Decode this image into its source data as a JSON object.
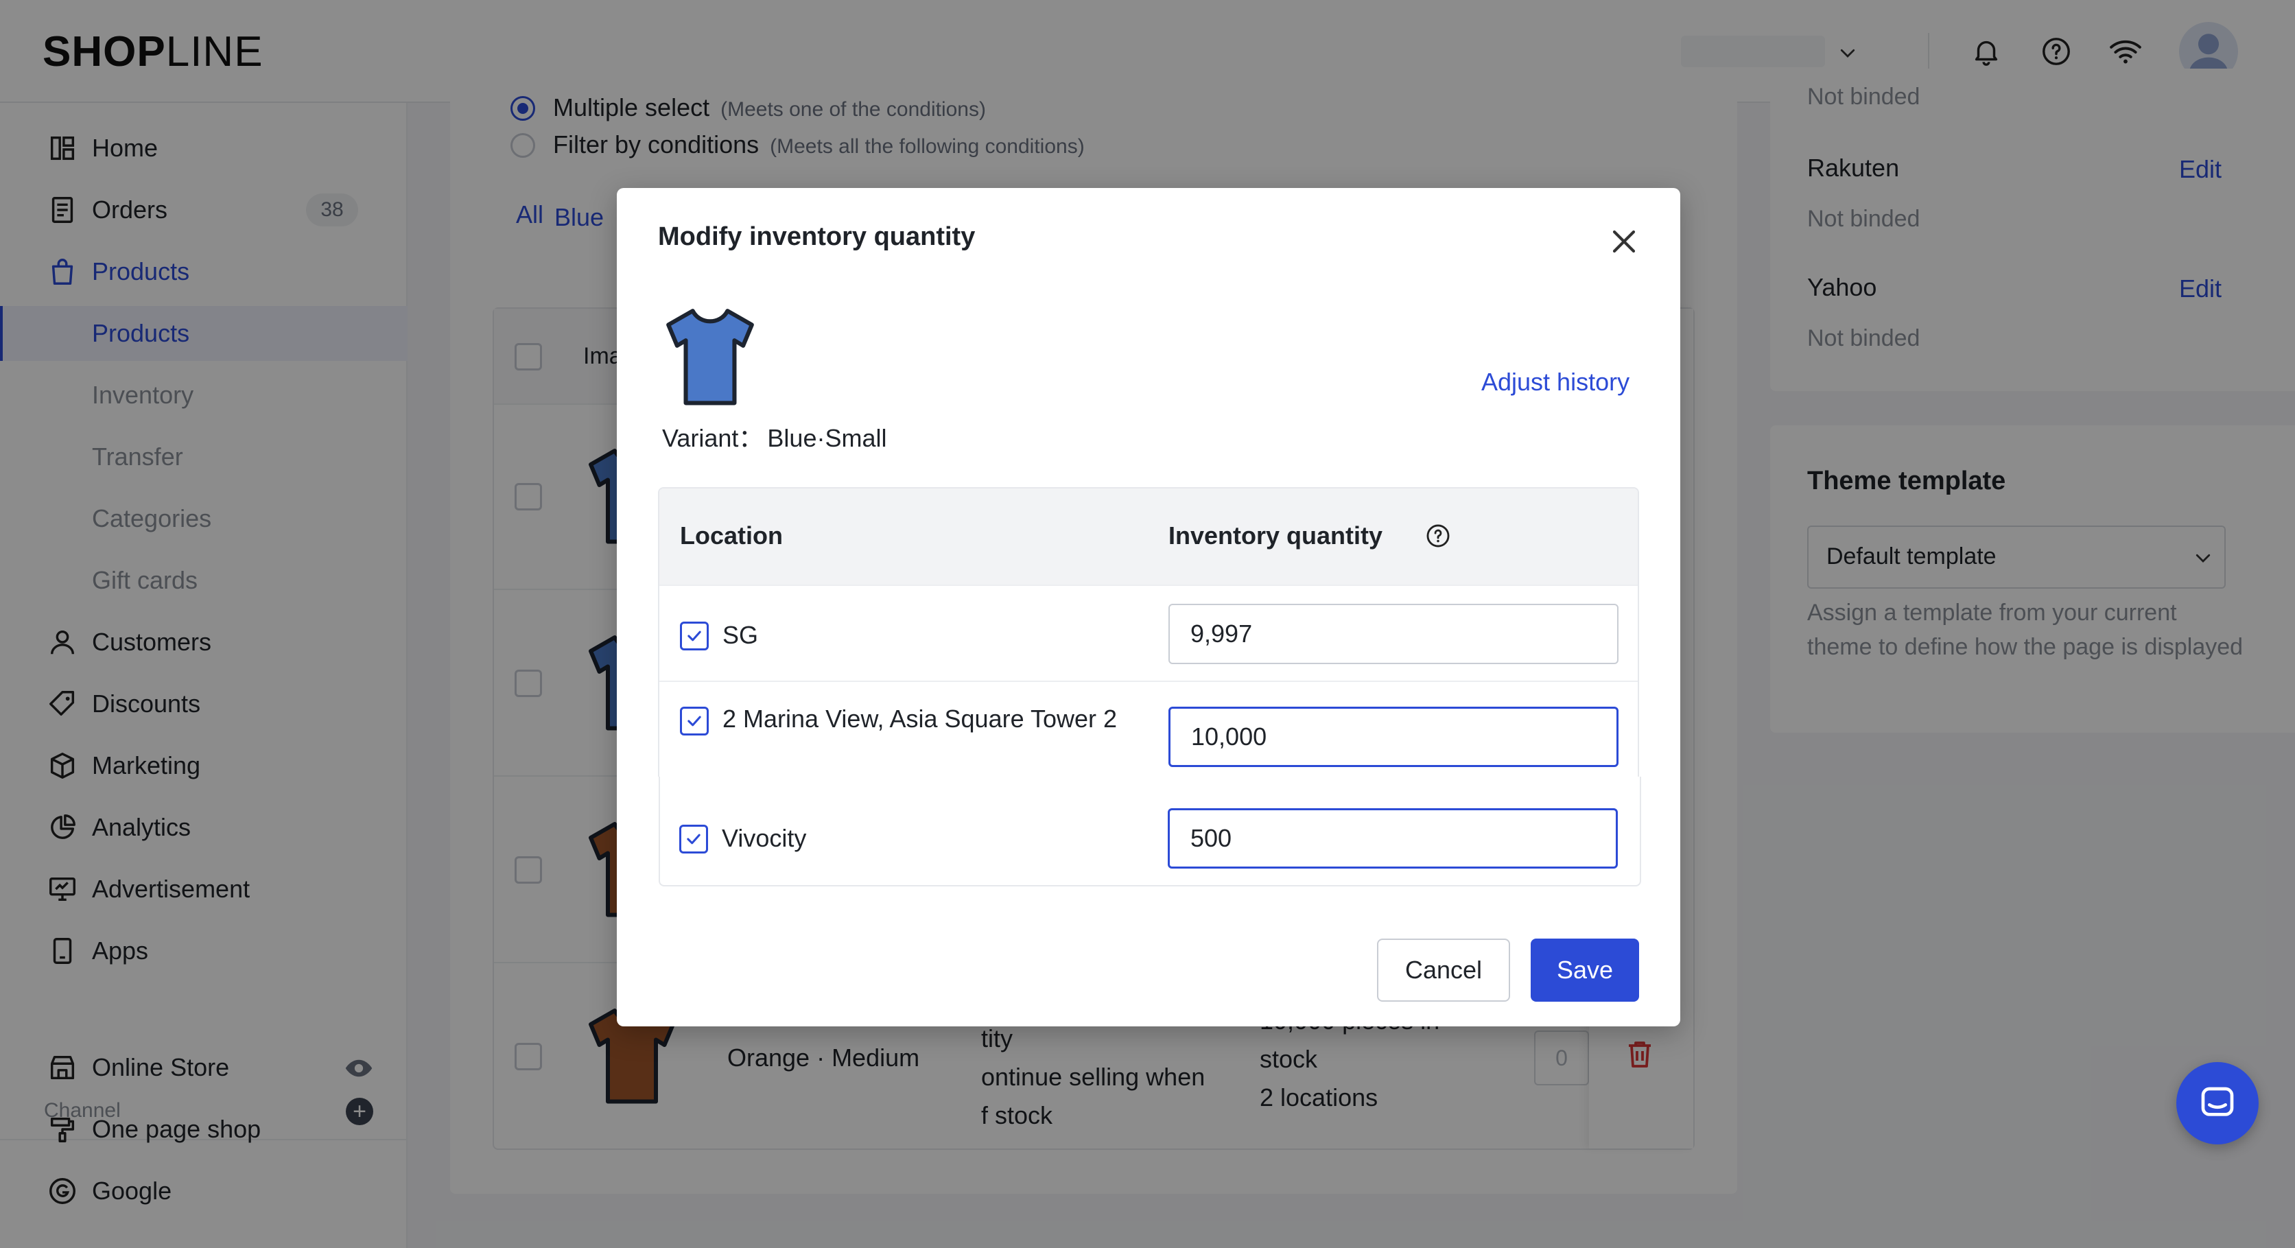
{
  "brand": {
    "logo_main": "SHOP",
    "logo_thin": "LINE"
  },
  "topbar": {
    "icons": [
      "chevron-down-icon",
      "bell-icon",
      "help-icon",
      "wifi-icon",
      "avatar-icon"
    ]
  },
  "sidebar": {
    "items": [
      {
        "label": "Home",
        "icon": "home-icon"
      },
      {
        "label": "Orders",
        "icon": "orders-icon",
        "badge": "38"
      },
      {
        "label": "Products",
        "icon": "bag-icon"
      },
      {
        "label": "Products"
      },
      {
        "label": "Inventory"
      },
      {
        "label": "Transfer"
      },
      {
        "label": "Categories"
      },
      {
        "label": "Gift cards"
      },
      {
        "label": "Customers",
        "icon": "user-icon"
      },
      {
        "label": "Discounts",
        "icon": "tag-icon"
      },
      {
        "label": "Marketing",
        "icon": "box-icon"
      },
      {
        "label": "Analytics",
        "icon": "pie-icon"
      },
      {
        "label": "Advertisement",
        "icon": "ad-icon"
      },
      {
        "label": "Apps",
        "icon": "apps-icon"
      },
      {
        "label": "Online Store",
        "icon": "store-icon"
      },
      {
        "label": "One page shop",
        "icon": "brush-icon"
      },
      {
        "label": "Google",
        "icon": "google-icon"
      }
    ],
    "channel_label": "Channel",
    "channel_add": "+"
  },
  "filters": {
    "multiple_select": "Multiple select",
    "multiple_select_note": "(Meets one of the conditions)",
    "filter_conditions": "Filter by conditions",
    "filter_conditions_note": "(Meets all the following conditions)",
    "tab_all": "All",
    "tab_blue": "Blue"
  },
  "table": {
    "col_image": "Ima",
    "last_row": {
      "variant": "Orange · Medium",
      "setting_lines": [
        "tity",
        "ontinue selling when",
        "f stock"
      ],
      "stock_lines": [
        "10,000 pieces in",
        "stock",
        "2 locations"
      ],
      "qty": "0"
    }
  },
  "right_panel": {
    "top_status": "Not binded",
    "channels": [
      {
        "name": "Rakuten",
        "status": "Not binded",
        "action": "Edit"
      },
      {
        "name": "Yahoo",
        "status": "Not binded",
        "action": "Edit"
      }
    ],
    "theme_title": "Theme template",
    "theme_value": "Default template",
    "theme_help": "Assign a template from your current theme to define how the page is displayed"
  },
  "modal": {
    "title": "Modify inventory quantity",
    "variant_label": "Variant：",
    "variant_value": "Blue·Small",
    "adjust_history": "Adjust history",
    "col_location": "Location",
    "col_quantity": "Inventory quantity",
    "rows": [
      {
        "location": "SG",
        "quantity": "9,997",
        "checked": true
      },
      {
        "location": "2 Marina View, Asia Square Tower 2",
        "quantity": "10,000",
        "checked": true
      },
      {
        "location": "Vivocity",
        "quantity": "500",
        "checked": true
      }
    ],
    "cancel": "Cancel",
    "save": "Save"
  },
  "colors": {
    "accent": "#2c4bd6",
    "shirt_blue": "#4a78c7",
    "shirt_orange": "#a0572a"
  }
}
